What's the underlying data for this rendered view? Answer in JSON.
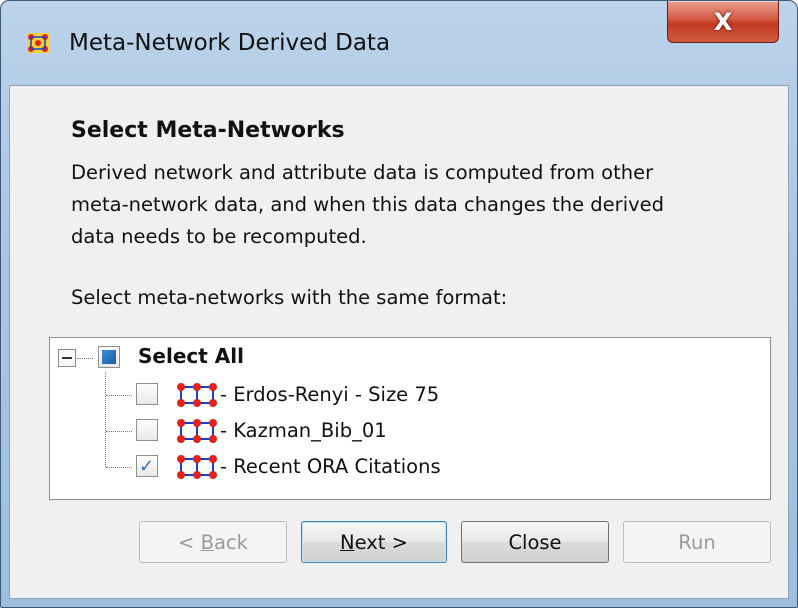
{
  "window": {
    "title": "Meta-Network Derived Data",
    "close_label": "X"
  },
  "content": {
    "heading": "Select Meta-Networks",
    "description_lines": [
      "Derived network and attribute data is computed from other",
      "meta-network data, and when this data changes the derived",
      "data needs to be recomputed."
    ],
    "select_label": "Select meta-networks with the same format:"
  },
  "tree": {
    "root": {
      "label": "Select All",
      "state": "partial"
    },
    "items": [
      {
        "label": "- Erdos-Renyi - Size 75",
        "checked": false
      },
      {
        "label": "- Kazman_Bib_01",
        "checked": false
      },
      {
        "label": "- Recent ORA Citations",
        "checked": true
      }
    ]
  },
  "buttons": {
    "back": {
      "prefix": "< ",
      "mnemonic": "B",
      "rest": "ack",
      "enabled": false
    },
    "next": {
      "mnemonic": "N",
      "rest": "ext >",
      "enabled": true
    },
    "close": {
      "label": "Close",
      "enabled": true
    },
    "run": {
      "label": "Run",
      "enabled": false
    }
  },
  "colors": {
    "title_bar": "#a9c6e3",
    "close_button": "#c43a22",
    "checkbox_accent": "#1b5fa6",
    "network_icon_nodes": "#e2231a",
    "network_icon_links": "#1a3fc4"
  }
}
